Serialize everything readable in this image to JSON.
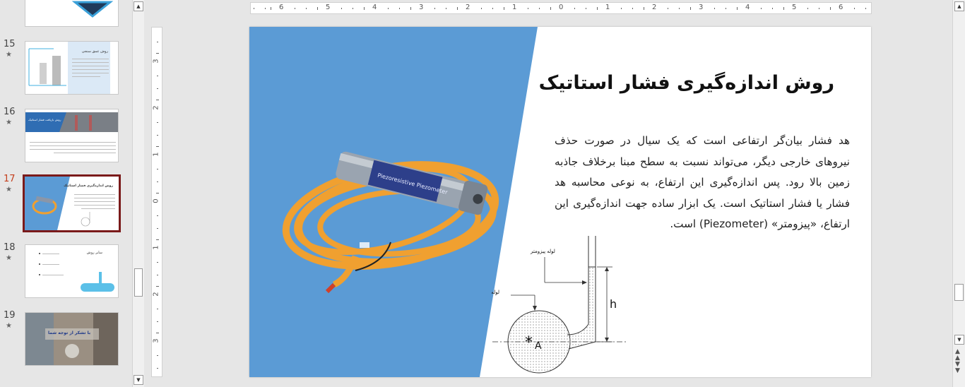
{
  "thumbnails": [
    {
      "number": "15",
      "title": "روش عمق سنجی"
    },
    {
      "number": "16",
      "title": "روش بازیافت فشار استاتیک"
    },
    {
      "number": "17",
      "title": "روش اندازه‌گیری فشار استاتیک",
      "selected": true
    },
    {
      "number": "18",
      "title": "سایر روش"
    },
    {
      "number": "19",
      "title": "با تشکر از توجه شما"
    }
  ],
  "star": "★",
  "ruler": {
    "horizontal": [
      "6",
      "5",
      "4",
      "3",
      "2",
      "1",
      "0",
      "1",
      "2",
      "3",
      "4",
      "5",
      "6"
    ],
    "vertical": [
      "3",
      "2",
      "1",
      "0",
      "1",
      "2",
      "3"
    ]
  },
  "slide": {
    "title": "روش اندازه‌گیری فشار استاتیک",
    "body": "هد فشار بیان‌گر ارتفاعی است که یک سیال در صورت حذف نیروهای خارجی دیگر، می‌تواند نسبت به سطح مبنا برخلاف جاذبه زمین بالا رود. پس اندازه‌گیری این ارتفاع، به نوعی محاسبه هد فشار یا فشار استاتیک است. یک ابزار ساده جهت اندازه‌گیری این ارتفاع، «پیزومتر» (Piezometer) است.",
    "diagram": {
      "label_pipe": "لوله",
      "label_piezometer": "لوله پیزومتر",
      "label_h": "h",
      "label_a": "A"
    },
    "device_label": "Piezoresistive Piezometer",
    "colors": {
      "panel_blue": "#5b9bd5",
      "cable_orange": "#f0a030"
    }
  }
}
